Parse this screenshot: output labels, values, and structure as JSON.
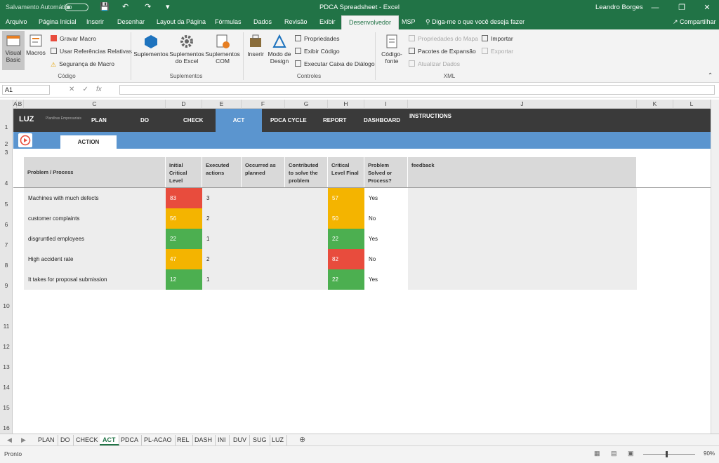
{
  "titlebar": {
    "autosave": "Salvamento Automático",
    "doc_title": "PDCA Spreadsheet  -  Excel",
    "user": "Leandro Borges"
  },
  "tabs": [
    "Arquivo",
    "Página Inicial",
    "Inserir",
    "Desenhar",
    "Layout da Página",
    "Fórmulas",
    "Dados",
    "Revisão",
    "Exibir",
    "Desenvolvedor",
    "MSP"
  ],
  "active_tab": "Desenvolvedor",
  "tell_me": "Diga-me o que você deseja fazer",
  "share": "Compartilhar",
  "ribbon": {
    "visual_basic": "Visual Basic",
    "macros": "Macros",
    "gravar_macro": "Gravar Macro",
    "usar_ref": "Usar Referências Relativas",
    "seguranca": "Segurança de Macro",
    "group_codigo": "Código",
    "suplementos": "Suplementos",
    "suplementos_excel": "Suplementos do Excel",
    "suplementos_com": "Suplementos COM",
    "group_suplementos": "Suplementos",
    "inserir": "Inserir",
    "modo_design": "Modo de Design",
    "propriedades": "Propriedades",
    "exibir_codigo": "Exibir Código",
    "executar_caixa": "Executar Caixa de Diálogo",
    "group_controles": "Controles",
    "codigo_fonte": "Código-fonte",
    "propriedades_mapa": "Propriedades do Mapa",
    "pacotes_expansao": "Pacotes de Expansão",
    "atualizar_dados": "Atualizar Dados",
    "importar": "Importar",
    "exportar": "Exportar",
    "group_xml": "XML"
  },
  "namebox": "A1",
  "fx": "fx",
  "columns": [
    "A",
    "B",
    "C",
    "D",
    "E",
    "F",
    "G",
    "H",
    "I",
    "J",
    "K",
    "L"
  ],
  "rows": [
    "1",
    "2",
    "3",
    "4",
    "5",
    "6",
    "7",
    "8",
    "9",
    "10",
    "11",
    "12",
    "13",
    "14",
    "15",
    "16"
  ],
  "sheet_nav": {
    "logo": "LUZ",
    "logo_sub": "Planilhas Empresariais",
    "items": [
      "PLAN",
      "DO",
      "CHECK",
      "ACT",
      "PDCA CYCLE",
      "REPORT",
      "DASHBOARD",
      "INSTRUCTIONS"
    ],
    "active": "ACT",
    "action_tab": "ACTION"
  },
  "table": {
    "headers": [
      "Problem / Process",
      "Initial Critical Level",
      "Executed actions",
      "Occurred as planned",
      "Contributed to solve the problem",
      "Critical Level Final",
      "Problem Solved or Process?",
      "feedback"
    ],
    "rows": [
      {
        "problem": "Machines with much defects",
        "initial": "83",
        "initial_color": "#e84c3d",
        "executed": "3",
        "final": "57",
        "final_color": "#f4b400",
        "solved": "Yes"
      },
      {
        "problem": "customer complaints",
        "initial": "56",
        "initial_color": "#f4b400",
        "executed": "2",
        "final": "50",
        "final_color": "#f4b400",
        "solved": "No"
      },
      {
        "problem": "disgruntled employees",
        "initial": "22",
        "initial_color": "#4caf50",
        "executed": "1",
        "final": "22",
        "final_color": "#4caf50",
        "solved": "Yes"
      },
      {
        "problem": "High accident rate",
        "initial": "47",
        "initial_color": "#f4b400",
        "executed": "2",
        "final": "82",
        "final_color": "#e84c3d",
        "solved": "No"
      },
      {
        "problem": "It takes for proposal submission",
        "initial": "12",
        "initial_color": "#4caf50",
        "executed": "1",
        "final": "22",
        "final_color": "#4caf50",
        "solved": "Yes"
      }
    ]
  },
  "sheet_tabs": [
    "PLAN",
    "DO",
    "CHECK",
    "ACT",
    "PDCA",
    "PL-ACAO",
    "REL",
    "DASH",
    "INI",
    "DUV",
    "SUG",
    "LUZ"
  ],
  "active_sheet": "ACT",
  "status": "Pronto",
  "zoom": "90%"
}
